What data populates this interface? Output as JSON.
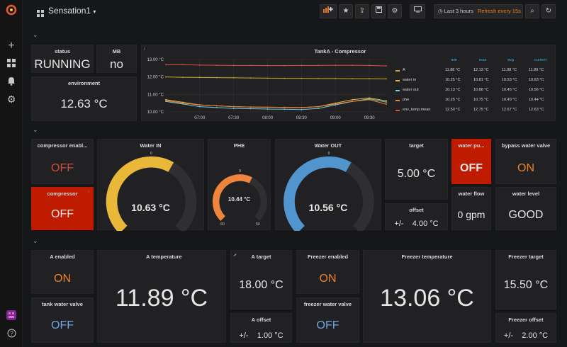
{
  "header": {
    "title": "Sensation1",
    "time_range": "Last 3 hours",
    "refresh": "Refresh every 15s"
  },
  "sidebar": {
    "icons": [
      "grafana-logo-icon",
      "plus-icon",
      "dashboards-icon",
      "bell-icon",
      "gear-icon",
      "avatar",
      "help-icon"
    ]
  },
  "panels": {
    "status": {
      "title": "status",
      "value": "RUNNING"
    },
    "mb": {
      "title": "MB",
      "value": "no"
    },
    "environment": {
      "title": "environment",
      "value": "12.63 °C"
    },
    "compressor_enabled": {
      "title": "compressor enabl...",
      "value": "OFF"
    },
    "compressor": {
      "title": "compressor",
      "value": "OFF"
    },
    "water_in": {
      "title": "Water IN",
      "value": "10.63 °C",
      "zero": "0",
      "min": "-50",
      "max": "50",
      "level": 0.61
    },
    "phe": {
      "title": "PHE",
      "value": "10.44 °C",
      "zero": "0",
      "min": "-50",
      "max": "50",
      "level": 0.6
    },
    "water_out": {
      "title": "Water OUT",
      "value": "10.56 °C",
      "zero": "0",
      "min": "-50",
      "max": "50",
      "level": 0.61
    },
    "target": {
      "title": "target",
      "value": "5.00 °C"
    },
    "offset": {
      "title": "offset",
      "sign": "+/-",
      "value": "4.00 °C"
    },
    "water_pump": {
      "title": "water pu...",
      "value": "OFF"
    },
    "bypass": {
      "title": "bypass water valve",
      "value": "ON"
    },
    "water_flow": {
      "title": "water flow",
      "value": "0 gpm"
    },
    "water_level": {
      "title": "water level",
      "value": "GOOD"
    },
    "a_enabled": {
      "title": "A enabled",
      "value": "ON"
    },
    "tank_valve": {
      "title": "tank water valve",
      "value": "OFF"
    },
    "a_temperature": {
      "title": "A temperature",
      "value": "11.89 °C"
    },
    "a_target": {
      "title": "A target",
      "value": "18.00 °C"
    },
    "a_offset": {
      "title": "A offset",
      "sign": "+/-",
      "value": "1.00 °C"
    },
    "freezer_enabled": {
      "title": "Freezer enabled",
      "value": "ON"
    },
    "freezer_valve": {
      "title": "freezer water valve",
      "value": "OFF"
    },
    "freezer_temperature": {
      "title": "Freezer temperature",
      "value": "13.06 °C"
    },
    "freezer_target": {
      "title": "Freezer target",
      "value": "15.50 °C"
    },
    "freezer_offset": {
      "title": "Freezer offset",
      "sign": "+/-",
      "value": "2.00 °C"
    }
  },
  "chart_data": {
    "type": "line",
    "title": "TankA - Compressor",
    "x": [
      "06:30",
      "06:45",
      "07:00",
      "07:15",
      "07:30",
      "07:45",
      "08:00",
      "08:15",
      "08:30",
      "08:45",
      "09:00",
      "09:15",
      "09:30",
      "09:40"
    ],
    "x_ticks": [
      "07:00",
      "07:30",
      "08:00",
      "08:30",
      "09:00",
      "09:30"
    ],
    "y_ticks": [
      "10.00 °C",
      "11.00 °C",
      "12.00 °C",
      "13.00 °C"
    ],
    "ylim": [
      10,
      13
    ],
    "series": [
      {
        "name": "A",
        "color": "#ccaa22",
        "values": [
          12.0,
          11.98,
          11.97,
          11.96,
          11.95,
          11.94,
          11.93,
          11.92,
          11.92,
          11.91,
          11.91,
          11.9,
          11.9,
          11.89
        ]
      },
      {
        "name": "water in",
        "color": "#eab839",
        "values": [
          10.7,
          10.55,
          10.4,
          10.35,
          10.3,
          10.28,
          10.27,
          10.26,
          10.25,
          10.3,
          10.5,
          10.7,
          10.8,
          10.63
        ]
      },
      {
        "name": "water out",
        "color": "#6ed0e0",
        "values": [
          10.6,
          10.45,
          10.3,
          10.25,
          10.2,
          10.18,
          10.16,
          10.15,
          10.13,
          10.2,
          10.4,
          10.6,
          10.75,
          10.56
        ]
      },
      {
        "name": "phe",
        "color": "#ef843c",
        "values": [
          10.65,
          10.5,
          10.4,
          10.35,
          10.3,
          10.28,
          10.27,
          10.26,
          10.25,
          10.3,
          10.45,
          10.6,
          10.7,
          10.44
        ]
      },
      {
        "name": "env_temp.mean",
        "color": "#e24d42",
        "values": [
          12.7,
          12.7,
          12.68,
          12.67,
          12.66,
          12.66,
          12.65,
          12.65,
          12.66,
          12.66,
          12.67,
          12.67,
          12.66,
          12.63
        ]
      }
    ],
    "legend": {
      "columns": [
        "min",
        "max",
        "avg",
        "current"
      ],
      "rows": [
        {
          "name": "A",
          "values": [
            "11.88 °C",
            "12.13 °C",
            "11.98 °C",
            "11.89 °C"
          ]
        },
        {
          "name": "water in",
          "values": [
            "10.25 °C",
            "10.81 °C",
            "10.53 °C",
            "10.63 °C"
          ]
        },
        {
          "name": "water out",
          "values": [
            "10.13 °C",
            "10.88 °C",
            "10.45 °C",
            "10.56 °C"
          ]
        },
        {
          "name": "phe",
          "values": [
            "10.25 °C",
            "10.75 °C",
            "10.49 °C",
            "10.44 °C"
          ]
        },
        {
          "name": "env_temp.mean",
          "values": [
            "12.50 °C",
            "12.75 °C",
            "12.67 °C",
            "12.63 °C"
          ]
        }
      ]
    }
  }
}
